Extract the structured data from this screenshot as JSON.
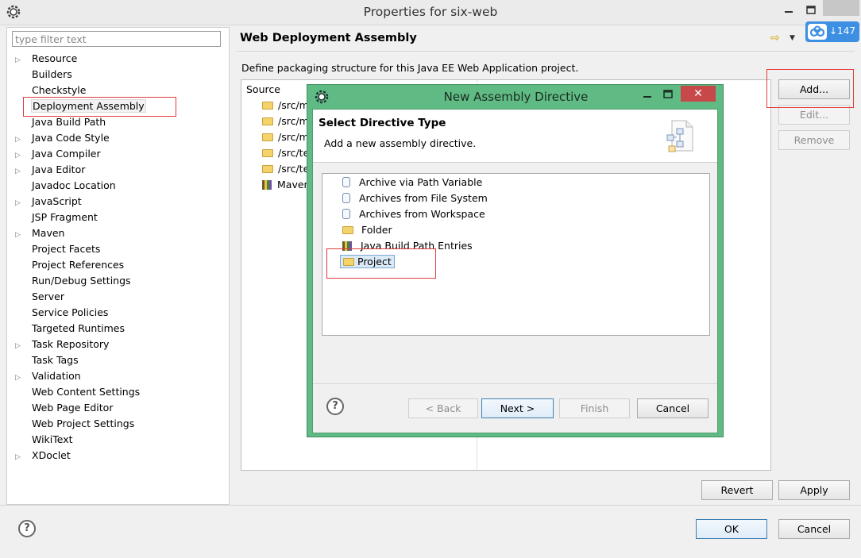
{
  "window": {
    "title": "Properties for six-web",
    "cloud_badge_count": "↓147"
  },
  "filter": {
    "placeholder": "type filter text"
  },
  "tree": [
    {
      "label": "Resource",
      "expandable": true
    },
    {
      "label": "Builders",
      "expandable": false
    },
    {
      "label": "Checkstyle",
      "expandable": false
    },
    {
      "label": "Deployment Assembly",
      "expandable": false,
      "selected": true
    },
    {
      "label": "Java Build Path",
      "expandable": false
    },
    {
      "label": "Java Code Style",
      "expandable": true
    },
    {
      "label": "Java Compiler",
      "expandable": true
    },
    {
      "label": "Java Editor",
      "expandable": true
    },
    {
      "label": "Javadoc Location",
      "expandable": false
    },
    {
      "label": "JavaScript",
      "expandable": true
    },
    {
      "label": "JSP Fragment",
      "expandable": false
    },
    {
      "label": "Maven",
      "expandable": true
    },
    {
      "label": "Project Facets",
      "expandable": false
    },
    {
      "label": "Project References",
      "expandable": false
    },
    {
      "label": "Run/Debug Settings",
      "expandable": false
    },
    {
      "label": "Server",
      "expandable": false
    },
    {
      "label": "Service Policies",
      "expandable": false
    },
    {
      "label": "Targeted Runtimes",
      "expandable": false
    },
    {
      "label": "Task Repository",
      "expandable": true
    },
    {
      "label": "Task Tags",
      "expandable": false
    },
    {
      "label": "Validation",
      "expandable": true
    },
    {
      "label": "Web Content Settings",
      "expandable": false
    },
    {
      "label": "Web Page Editor",
      "expandable": false
    },
    {
      "label": "Web Project Settings",
      "expandable": false
    },
    {
      "label": "WikiText",
      "expandable": false
    },
    {
      "label": "XDoclet",
      "expandable": true
    }
  ],
  "page": {
    "title": "Web Deployment Assembly",
    "description": "Define packaging structure for this Java EE Web Application project.",
    "column_source": "Source",
    "sources": [
      {
        "label": "/src/m",
        "icon": "folder"
      },
      {
        "label": "/src/m",
        "icon": "folder"
      },
      {
        "label": "/src/m",
        "icon": "folder"
      },
      {
        "label": "/src/te",
        "icon": "folder"
      },
      {
        "label": "/src/te",
        "icon": "folder"
      },
      {
        "label": "Maven",
        "icon": "libraries"
      }
    ],
    "add_label": "Add...",
    "edit_label": "Edit...",
    "remove_label": "Remove",
    "revert_label": "Revert",
    "apply_label": "Apply"
  },
  "footer": {
    "ok_label": "OK",
    "cancel_label": "Cancel"
  },
  "dialog": {
    "title": "New Assembly Directive",
    "heading": "Select Directive Type",
    "subheading": "Add a new assembly directive.",
    "close_glyph": "✕",
    "items": [
      {
        "label": "Archive via Path Variable",
        "icon": "jar"
      },
      {
        "label": "Archives from File System",
        "icon": "jar"
      },
      {
        "label": "Archives from Workspace",
        "icon": "jar"
      },
      {
        "label": "Folder",
        "icon": "folder"
      },
      {
        "label": "Java Build Path Entries",
        "icon": "libraries"
      },
      {
        "label": "Project",
        "icon": "folder-open",
        "selected": true
      }
    ],
    "back_label": "< Back",
    "next_label": "Next >",
    "finish_label": "Finish",
    "cancel_label": "Cancel"
  },
  "colors": {
    "dialog_frame": "#5fbb83",
    "highlight_box": "#e23b3b",
    "selection": "#dbeaf8"
  }
}
